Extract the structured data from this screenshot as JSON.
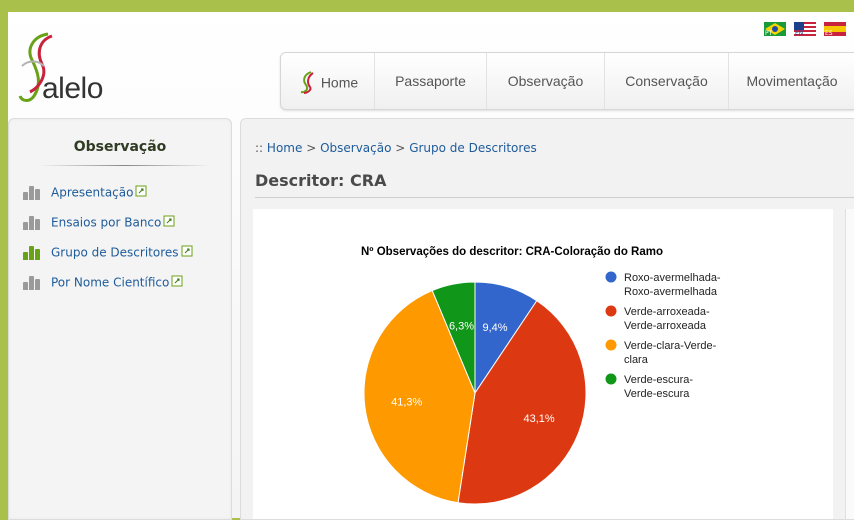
{
  "brand": {
    "name": "alelo"
  },
  "languages": [
    "PT",
    "EN",
    "ES"
  ],
  "nav": [
    {
      "label": "Home"
    },
    {
      "label": "Passaporte"
    },
    {
      "label": "Observação"
    },
    {
      "label": "Conservação"
    },
    {
      "label": "Movimentação"
    }
  ],
  "sidebar": {
    "title": "Observação",
    "items": [
      {
        "label": "Apresentação",
        "active": false
      },
      {
        "label": "Ensaios por Banco",
        "active": false
      },
      {
        "label": "Grupo de Descritores",
        "active": true
      },
      {
        "label": "Por Nome Científico",
        "active": false
      }
    ]
  },
  "breadcrumb": {
    "prefix": "::",
    "items": [
      "Home",
      "Observação",
      "Grupo de Descritores"
    ],
    "separator": ">"
  },
  "page_title": "Descritor: CRA",
  "chart_data": {
    "type": "pie",
    "title": "Nº Observações do descritor: CRA-Coloração do Ramo",
    "legend_position": "right",
    "slices": [
      {
        "name": "Roxo-avermelhada-Roxo-avermelhada",
        "legend_lines": [
          "Roxo-avermelhada-",
          "Roxo-avermelhada"
        ],
        "value": 9.4,
        "label": "9,4%",
        "color": "#3366cc"
      },
      {
        "name": "Verde-arroxeada-Verde-arroxeada",
        "legend_lines": [
          "Verde-arroxeada-",
          "Verde-arroxeada"
        ],
        "value": 43.1,
        "label": "43,1%",
        "color": "#dc3912"
      },
      {
        "name": "Verde-clara-Verde-clara",
        "legend_lines": [
          "Verde-clara-Verde-",
          "clara"
        ],
        "value": 41.3,
        "label": "41,3%",
        "color": "#ff9900"
      },
      {
        "name": "Verde-escura-Verde-escura",
        "legend_lines": [
          "Verde-escura-",
          "Verde-escura"
        ],
        "value": 6.3,
        "label": "6,3%",
        "color": "#109618"
      }
    ]
  },
  "colors": {
    "frame": "#a9c04a",
    "link": "#1e5b9a",
    "active_icon": "#6aa217",
    "inactive_icon": "#9a9a9a"
  }
}
